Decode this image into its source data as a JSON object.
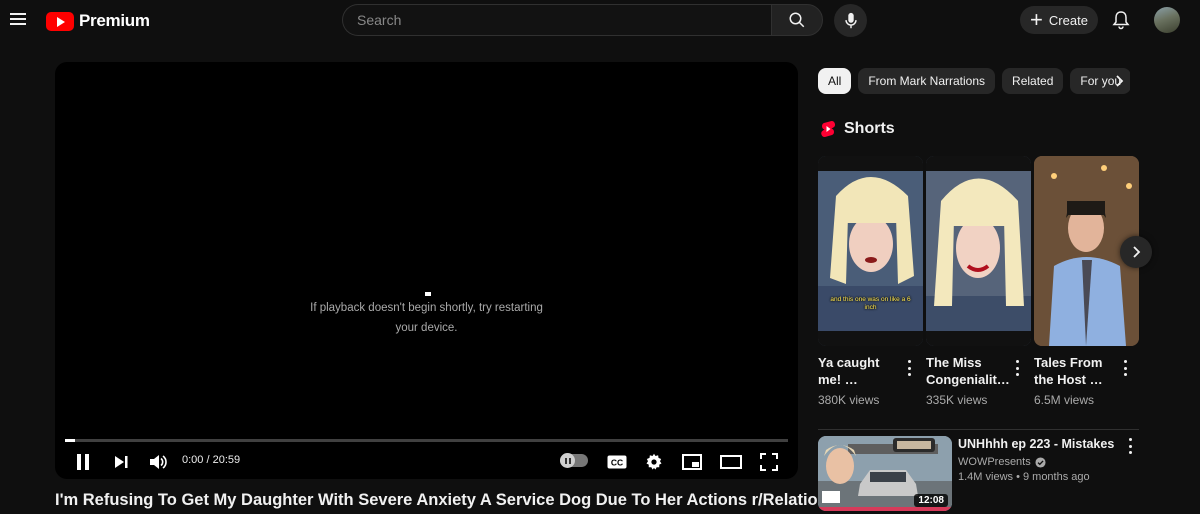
{
  "header": {
    "logo_text": "Premium",
    "search_placeholder": "Search",
    "create_label": "Create"
  },
  "player": {
    "playback_message_line1": "If playback doesn't begin shortly, try restarting",
    "playback_message_line2": "your device.",
    "time_display": "0:00 / 20:59",
    "progress_fraction": 0.014
  },
  "video": {
    "title": "I'm Refusing To Get My Daughter With Severe Anxiety A Service Dog Due To Her Actions r/Relationships"
  },
  "chips": [
    "All",
    "From Mark Narrations",
    "Related",
    "For you"
  ],
  "shorts": {
    "heading": "Shorts",
    "items": [
      {
        "title_line1": "Ya caught",
        "title_line2": "me! …",
        "views": "380K views",
        "caption": "and this one was on like a 6 inch"
      },
      {
        "title_line1": "The Miss",
        "title_line2": "Congenialit…",
        "views": "335K views"
      },
      {
        "title_line1": "Tales From",
        "title_line2": "the Host …",
        "views": "6.5M views"
      }
    ]
  },
  "recommended": [
    {
      "title": "UNHhhh ep 223 - Mistakes",
      "channel": "WOWPresents",
      "meta": "1.4M views • 9 months ago",
      "duration": "12:08"
    }
  ],
  "colors": {
    "background": "#0f0f0f",
    "brand_red": "#ff0000",
    "chip_bg": "#272727",
    "chip_active_bg": "#f1f1f1"
  }
}
